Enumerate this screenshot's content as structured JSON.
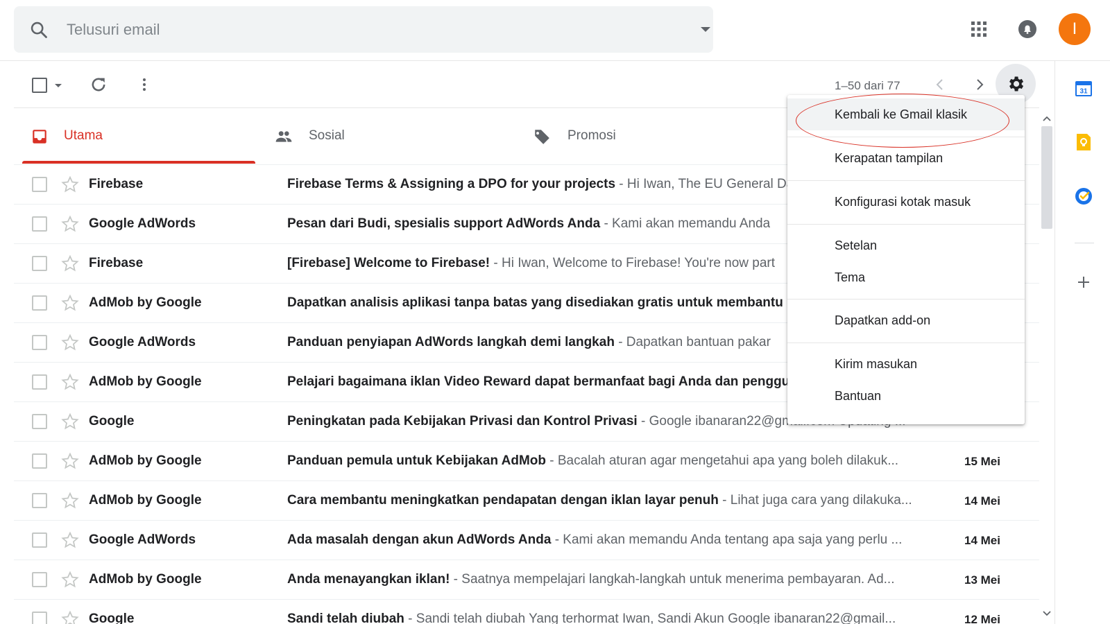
{
  "search": {
    "placeholder": "Telusuri email"
  },
  "header": {
    "avatar_initial": "I"
  },
  "toolbar": {
    "pager": "1–50 dari 77"
  },
  "tabs": [
    {
      "label": "Utama",
      "icon": "inbox-icon",
      "active": true
    },
    {
      "label": "Sosial",
      "icon": "people-icon",
      "active": false
    },
    {
      "label": "Promosi",
      "icon": "tag-icon",
      "active": false
    }
  ],
  "emails": [
    {
      "sender": "Firebase",
      "subject": "Firebase Terms & Assigning a DPO for your projects",
      "snippet": " - Hi Iwan, The EU General Data Protection Regulation",
      "date": ""
    },
    {
      "sender": "Google AdWords",
      "subject": "Pesan dari Budi, spesialis support AdWords Anda",
      "snippet": " - Kami akan memandu Anda",
      "date": ""
    },
    {
      "sender": "Firebase",
      "subject": "[Firebase] Welcome to Firebase!",
      "snippet": " - Hi Iwan, Welcome to Firebase! You're now part",
      "date": ""
    },
    {
      "sender": "AdMob by Google",
      "subject": "Dapatkan analisis aplikasi tanpa batas yang disediakan gratis untuk membantu",
      "snippet": "",
      "date": ""
    },
    {
      "sender": "Google AdWords",
      "subject": "Panduan penyiapan AdWords langkah demi langkah",
      "snippet": " - Dapatkan bantuan pakar",
      "date": ""
    },
    {
      "sender": "AdMob by Google",
      "subject": "Pelajari bagaimana iklan Video Reward dapat bermanfaat bagi Anda dan pengguna",
      "snippet": "",
      "date": ""
    },
    {
      "sender": "Google",
      "subject": "Peningkatan pada Kebijakan Privasi dan Kontrol Privasi",
      "snippet": " - Google ibanaran22@gmail.com Updating ...",
      "date": ""
    },
    {
      "sender": "AdMob by Google",
      "subject": "Panduan pemula untuk Kebijakan AdMob",
      "snippet": " - Bacalah aturan agar mengetahui apa yang boleh dilakuk...",
      "date": "15 Mei"
    },
    {
      "sender": "AdMob by Google",
      "subject": "Cara membantu meningkatkan pendapatan dengan iklan layar penuh",
      "snippet": " - Lihat juga cara yang dilakuka...",
      "date": "14 Mei"
    },
    {
      "sender": "Google AdWords",
      "subject": "Ada masalah dengan akun AdWords Anda",
      "snippet": " - Kami akan memandu Anda tentang apa saja yang perlu ...",
      "date": "14 Mei"
    },
    {
      "sender": "AdMob by Google",
      "subject": "Anda menayangkan iklan!",
      "snippet": " - Saatnya mempelajari langkah-langkah untuk menerima pembayaran. Ad...",
      "date": "13 Mei"
    },
    {
      "sender": "Google",
      "subject": "Sandi telah diubah",
      "snippet": " - Sandi telah diubah Yang terhormat Iwan, Sandi Akun Google ibanaran22@gmail...",
      "date": "12 Mei"
    }
  ],
  "settings_menu": {
    "items": [
      "Kembali ke Gmail klasik",
      "Kerapatan tampilan",
      "Konfigurasi kotak masuk",
      "Setelan",
      "Tema",
      "Dapatkan add-on",
      "Kirim masukan",
      "Bantuan"
    ]
  },
  "side_panel": {
    "calendar_day": "31"
  },
  "colors": {
    "accent": "#d93025",
    "avatar": "#f4760e",
    "calendar": "#1a73e8",
    "keep": "#fbbc04",
    "tasks": "#1a73e8"
  }
}
